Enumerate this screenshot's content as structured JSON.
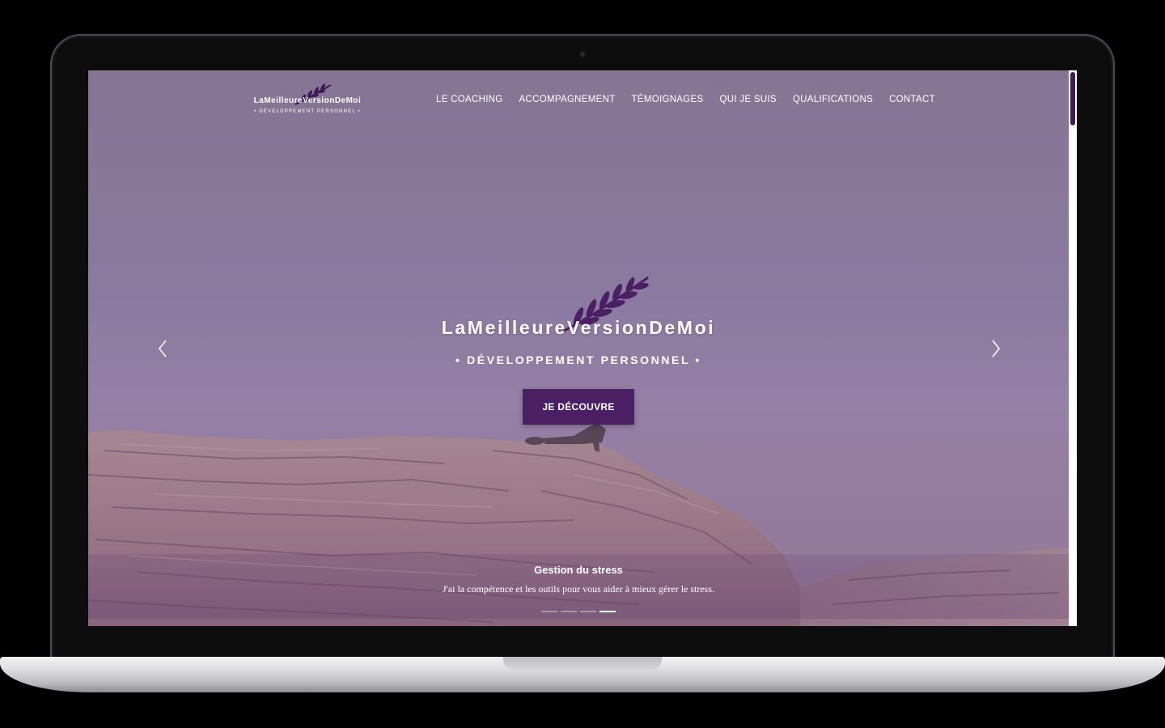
{
  "brand": {
    "name": "LaMeilleureVersionDeMoi",
    "tagline": "• DÉVELOPPEMENT PERSONNEL •",
    "accent": "#4a1f63"
  },
  "nav": {
    "items": [
      {
        "label": "LE COACHING"
      },
      {
        "label": "ACCOMPAGNEMENT"
      },
      {
        "label": "TÉMOIGNAGES"
      },
      {
        "label": "QUI JE SUIS"
      },
      {
        "label": "QUALIFICATIONS"
      },
      {
        "label": "CONTACT"
      }
    ]
  },
  "hero": {
    "title": "LaMeilleureVersionDeMoi",
    "subtitle": "• DÉVELOPPEMENT PERSONNEL •",
    "cta_label": "JE DÉCOUVRE",
    "prev_icon": "chevron-left-icon",
    "next_icon": "chevron-right-icon"
  },
  "slide": {
    "title": "Gestion du stress",
    "text": "J'ai la compétence et les outils pour vous aider à mieux gérer le stress.",
    "count": 4,
    "active_index": 3
  }
}
